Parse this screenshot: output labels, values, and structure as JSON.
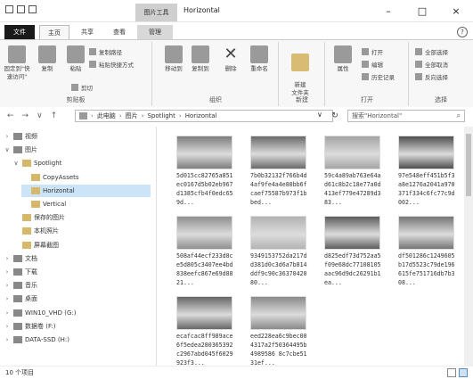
{
  "window": {
    "title": "Horizontal",
    "context_tab_group": "图片工具",
    "buttons": [
      "–",
      "□",
      "×"
    ]
  },
  "ribbon_tabs": [
    {
      "label": "文件"
    },
    {
      "label": "主页"
    },
    {
      "label": "共享"
    },
    {
      "label": "查看"
    },
    {
      "label": "管理"
    }
  ],
  "ribbon": {
    "clipboard": {
      "name": "剪贴板",
      "pin": "固定到\"快速访问\"",
      "copy": "复制",
      "paste": "粘贴",
      "copy_path": "复制路径",
      "paste_shortcut": "粘贴快捷方式",
      "cut": "剪切"
    },
    "organize": {
      "name": "组织",
      "move_to": "移动到",
      "copy_to": "复制到",
      "delete": "删除",
      "rename": "重命名"
    },
    "new": {
      "name": "新建",
      "new_folder": "新建\n文件夹"
    },
    "open": {
      "name": "打开",
      "properties": "属性",
      "open": "打开",
      "edit": "编辑",
      "history": "历史记录"
    },
    "select": {
      "name": "选择",
      "select_all": "全部选择",
      "select_none": "全部取消",
      "invert": "反向选择"
    }
  },
  "address": {
    "path": [
      "此电脑",
      "图片",
      "Spotlight",
      "Horizontal"
    ],
    "search_placeholder": "搜索\"Horizontal\""
  },
  "nav": [
    {
      "label": "视频",
      "expand": "›",
      "indent": 0
    },
    {
      "label": "图片",
      "expand": "∨",
      "indent": 0
    },
    {
      "label": "Spotlight",
      "expand": "∨",
      "indent": 1
    },
    {
      "label": "CopyAssets",
      "expand": "",
      "indent": 2
    },
    {
      "label": "Horizontal",
      "expand": "",
      "indent": 2,
      "selected": true
    },
    {
      "label": "Vertical",
      "expand": "",
      "indent": 2
    },
    {
      "label": "保存的图片",
      "expand": "",
      "indent": 1
    },
    {
      "label": "本机照片",
      "expand": "",
      "indent": 1
    },
    {
      "label": "屏幕截图",
      "expand": "",
      "indent": 1
    },
    {
      "label": "文档",
      "expand": "›",
      "indent": 0
    },
    {
      "label": "下载",
      "expand": "›",
      "indent": 0
    },
    {
      "label": "音乐",
      "expand": "›",
      "indent": 0
    },
    {
      "label": "桌面",
      "expand": "›",
      "indent": 0
    },
    {
      "label": "WIN10_VHD (G:)",
      "expand": "›",
      "indent": 0
    },
    {
      "label": "数据卷 (F:)",
      "expand": "›",
      "indent": 0
    },
    {
      "label": "DATA-SSD (H:)",
      "expand": "›",
      "indent": 0
    }
  ],
  "files": [
    {
      "name": "5d015cc82765a851ec0167d5b02eb967d1385cfb4f0edc659d...",
      "tone": "#7d7d7d"
    },
    {
      "name": "7b0b32132f766b4d4af9fe4a4e80bb6fcaef75587b973f1bbed...",
      "tone": "#6a6a6a"
    },
    {
      "name": "59c4a89ab763e64ad61c8b2c18e77a0d413ef779e47289d383...",
      "tone": "#a5a5a5"
    },
    {
      "name": "97e548eff451b5f3a8e1276a2041a970371f334c6fc77c9d002...",
      "tone": "#4e4e4e"
    },
    {
      "name": "508af44ecf233d8ce5d805c3407ee4bd838eefc867e69d8821...",
      "tone": "#8f8f8f"
    },
    {
      "name": "9349153752da217dd381d0c3d6a7b814ddf9c90c3637042080...",
      "tone": "#b3b3b3"
    },
    {
      "name": "d825edf73d752aa5f09e68dc77108105aac96d9dc26291b1ea...",
      "tone": "#5c5c5c"
    },
    {
      "name": "df501286c1249605b17d5523c79de196615fe751716db7b308...",
      "tone": "#757575"
    },
    {
      "name": "ecafcac8ff989ace6f5edea280365392c2967abd045f6029923f3...",
      "tone": "#666666"
    },
    {
      "name": "eed228ea6c9bec004317a2f50364495b4989586 8c7cbe5131ef...",
      "tone": "#8a8a8a"
    }
  ],
  "status": {
    "count": "10 个项目"
  }
}
